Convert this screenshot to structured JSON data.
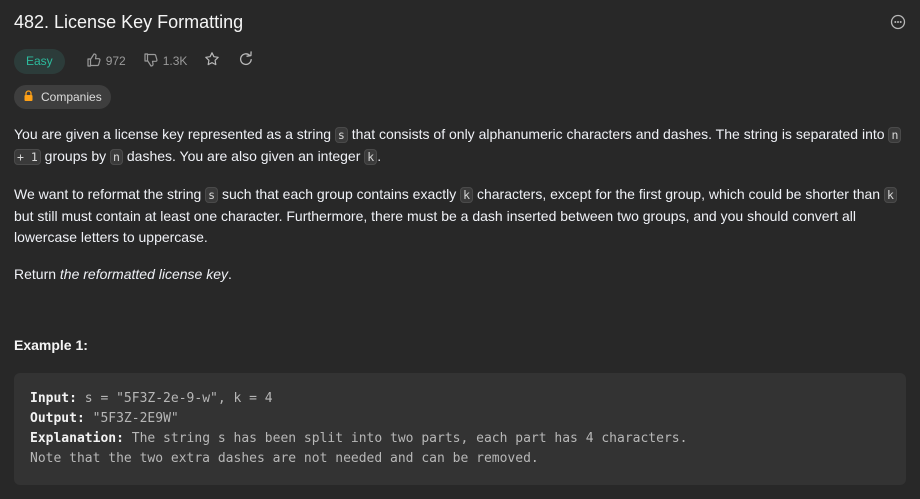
{
  "problem": {
    "title": "482. License Key Formatting",
    "difficulty": "Easy",
    "likes": "972",
    "dislikes": "1.3K",
    "companies_label": "Companies"
  },
  "description": {
    "p1": {
      "t1": "You are given a license key represented as a string ",
      "c1": "s",
      "t2": " that consists of only alphanumeric characters and dashes. The string is separated into ",
      "c2": "n",
      "c3": "+ 1",
      "t3": " groups by ",
      "c4": "n",
      "t4": " dashes. You are also given an integer ",
      "c5": "k",
      "t5": "."
    },
    "p2": {
      "t1": "We want to reformat the string ",
      "c1": "s",
      "t2": " such that each group contains exactly ",
      "c2": "k",
      "t3": " characters, except for the first group, which could be shorter than ",
      "c3": "k",
      "t4": " but still must contain at least one character. Furthermore, there must be a dash inserted between two groups, and you should convert all lowercase letters to uppercase."
    },
    "p3": {
      "t1": "Return ",
      "em": "the reformatted license key",
      "t2": "."
    }
  },
  "example1": {
    "heading": "Example 1:",
    "input_label": "Input:",
    "input_value": " s = \"5F3Z-2e-9-w\", k = 4",
    "output_label": "Output:",
    "output_value": " \"5F3Z-2E9W\"",
    "explanation_label": "Explanation:",
    "explanation_value": " The string s has been split into two parts, each part has 4 characters.",
    "note": "Note that the two extra dashes are not needed and can be removed."
  },
  "colors": {
    "background": "#282828",
    "easy": "#2cbb9d",
    "text": "#eff1f6"
  }
}
